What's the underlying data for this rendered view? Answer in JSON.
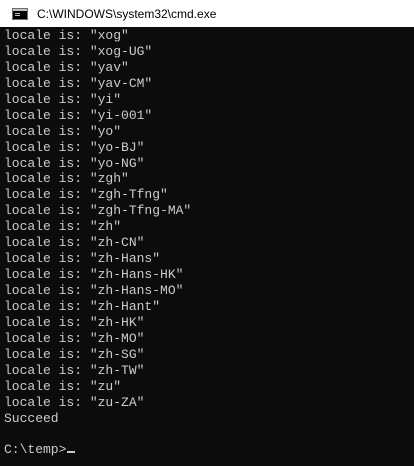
{
  "window": {
    "title": "C:\\WINDOWS\\system32\\cmd.exe"
  },
  "console": {
    "lines": [
      "locale is: \"xog\"",
      "locale is: \"xog-UG\"",
      "locale is: \"yav\"",
      "locale is: \"yav-CM\"",
      "locale is: \"yi\"",
      "locale is: \"yi-001\"",
      "locale is: \"yo\"",
      "locale is: \"yo-BJ\"",
      "locale is: \"yo-NG\"",
      "locale is: \"zgh\"",
      "locale is: \"zgh-Tfng\"",
      "locale is: \"zgh-Tfng-MA\"",
      "locale is: \"zh\"",
      "locale is: \"zh-CN\"",
      "locale is: \"zh-Hans\"",
      "locale is: \"zh-Hans-HK\"",
      "locale is: \"zh-Hans-MO\"",
      "locale is: \"zh-Hant\"",
      "locale is: \"zh-HK\"",
      "locale is: \"zh-MO\"",
      "locale is: \"zh-SG\"",
      "locale is: \"zh-TW\"",
      "locale is: \"zu\"",
      "locale is: \"zu-ZA\"",
      "Succeed",
      "",
      "C:\\temp>"
    ]
  },
  "colors": {
    "console_background": "#0c0c0c",
    "console_text": "#cccccc",
    "titlebar_background": "#ffffff"
  },
  "icons": {
    "app": "cmd-console-icon"
  }
}
